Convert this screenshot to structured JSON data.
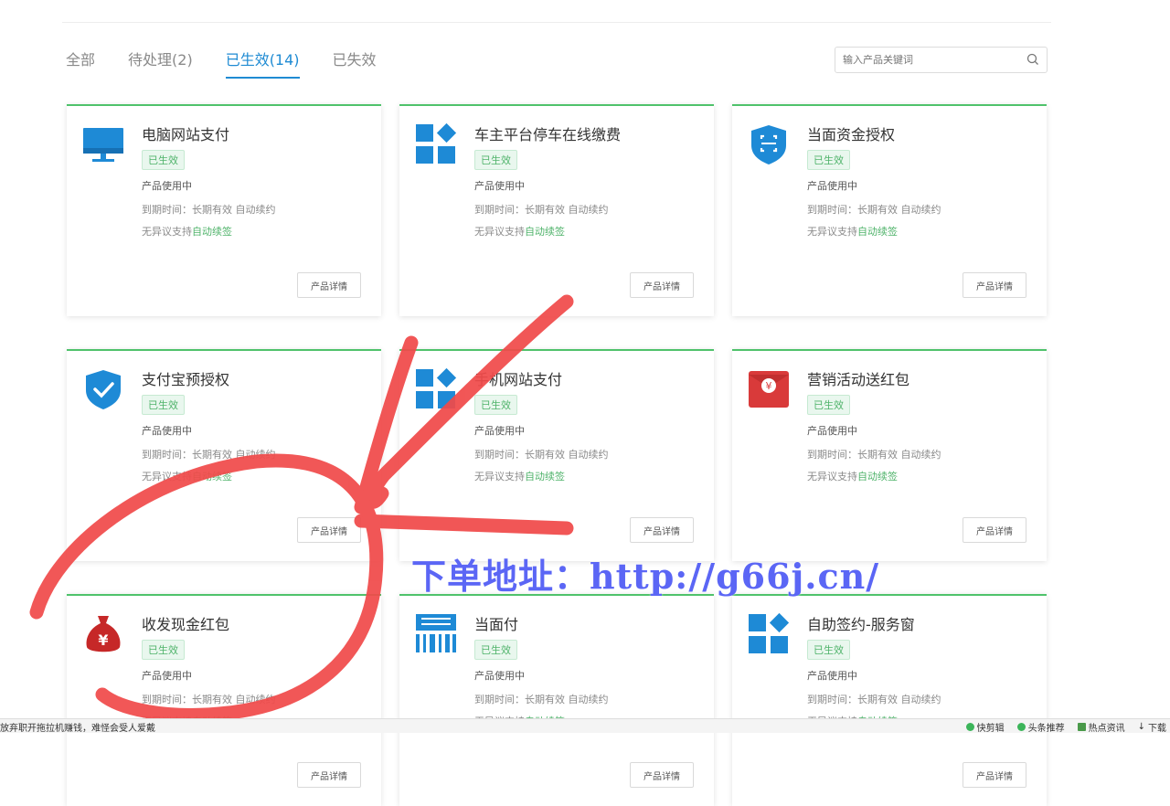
{
  "tabs": [
    {
      "label": "全部",
      "active": false
    },
    {
      "label": "待处理(2)",
      "active": false
    },
    {
      "label": "已生效(14)",
      "active": true
    },
    {
      "label": "已失效",
      "active": false
    }
  ],
  "search": {
    "placeholder": "输入产品关键词",
    "icon": "search-icon"
  },
  "card_common": {
    "status_badge": "已生效",
    "usage": "产品使用中",
    "expiry": "到期时间：长期有效 自动续约",
    "support_prefix": "无异议支持",
    "support_link": "自动续签",
    "detail_button": "产品详情"
  },
  "cards": [
    {
      "title": "电脑网站支付",
      "icon": "monitor-icon"
    },
    {
      "title": "车主平台停车在线缴费",
      "icon": "app-grid-icon"
    },
    {
      "title": "当面资金授权",
      "icon": "shield-scan-icon"
    },
    {
      "title": "支付宝预授权",
      "icon": "shield-check-icon"
    },
    {
      "title": "手机网站支付",
      "icon": "app-grid-icon"
    },
    {
      "title": "营销活动送红包",
      "icon": "red-envelope-icon"
    },
    {
      "title": "收发现金红包",
      "icon": "money-bag-icon"
    },
    {
      "title": "当面付",
      "icon": "barcode-icon"
    },
    {
      "title": "自助签约-服务窗",
      "icon": "app-grid-icon"
    }
  ],
  "watermark": "下单地址：http://g66j.cn/",
  "statusbar": {
    "left": "放弃职开拖拉机赚钱，难怪会受人爱戴",
    "items": [
      "快剪辑",
      "头条推荐",
      "热点资讯",
      "下载"
    ]
  },
  "colors": {
    "accent": "#1f8bd3",
    "success": "#4fc26b",
    "icon_blue": "#1e8ad6",
    "red_icon": "#d93a3a",
    "scribble": "#f04a4a",
    "watermark": "#5b66f5"
  }
}
